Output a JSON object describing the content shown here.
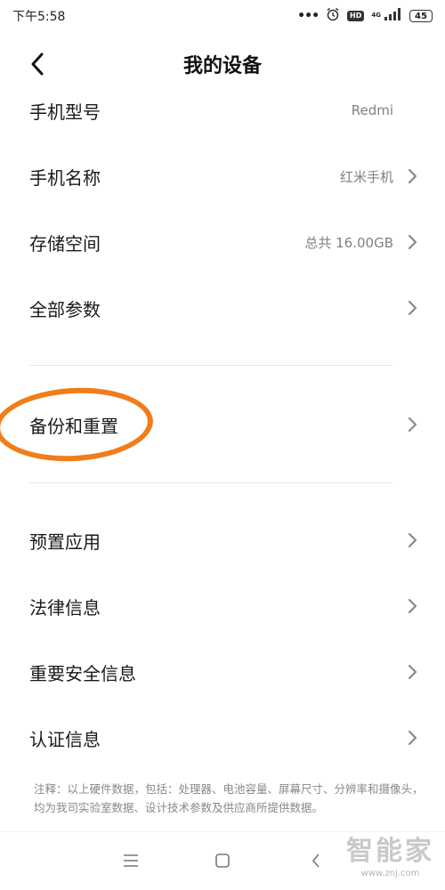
{
  "status_bar": {
    "time": "下午5:58",
    "dots": "•••",
    "hd": "HD",
    "network": "4G",
    "battery": "45",
    "icons": [
      "alarm-icon",
      "signal-icon"
    ]
  },
  "header": {
    "title": "我的设备",
    "back_icon": "chevron-left-icon"
  },
  "rows": [
    {
      "label": "手机型号",
      "value": "Redmi"
    },
    {
      "label": "手机名称",
      "value": "红米手机"
    },
    {
      "label": "存储空间",
      "value": "总共 16.00GB"
    },
    {
      "label": "全部参数",
      "value": ""
    },
    {
      "label": "备份和重置",
      "value": ""
    },
    {
      "label": "预置应用",
      "value": ""
    },
    {
      "label": "法律信息",
      "value": ""
    },
    {
      "label": "重要安全信息",
      "value": ""
    },
    {
      "label": "认证信息",
      "value": ""
    }
  ],
  "note": "注释：以上硬件数据，包括：处理器、电池容量、屏幕尺寸、分辨率和摄像头，均为我司实验室数据、设计技术参数及供应商所提供数据。",
  "nav": {
    "icons": [
      "menu-icon",
      "home-icon",
      "back-icon"
    ]
  },
  "watermark": {
    "main": "智能家",
    "sub": "www.znj.com"
  },
  "colors": {
    "highlight": "#f07d1a",
    "text": "#1a1a1a",
    "secondary": "#808080"
  }
}
